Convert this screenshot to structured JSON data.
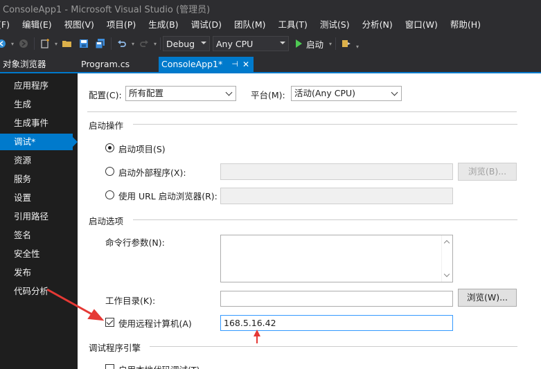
{
  "window": {
    "title": "ConsoleApp1 - Microsoft Visual Studio (管理员)"
  },
  "menu": [
    {
      "label": "(F)",
      "name": "menu-file"
    },
    {
      "label": "编辑(E)",
      "name": "menu-edit"
    },
    {
      "label": "视图(V)",
      "name": "menu-view"
    },
    {
      "label": "项目(P)",
      "name": "menu-project"
    },
    {
      "label": "生成(B)",
      "name": "menu-build"
    },
    {
      "label": "调试(D)",
      "name": "menu-debug"
    },
    {
      "label": "团队(M)",
      "name": "menu-team"
    },
    {
      "label": "工具(T)",
      "name": "menu-tools"
    },
    {
      "label": "测试(S)",
      "name": "menu-test"
    },
    {
      "label": "分析(N)",
      "name": "menu-analyze"
    },
    {
      "label": "窗口(W)",
      "name": "menu-window"
    },
    {
      "label": "帮助(H)",
      "name": "menu-help"
    }
  ],
  "toolbar": {
    "config": "Debug",
    "platform": "Any CPU",
    "start_label": "启动"
  },
  "tabs": {
    "object_browser": "对象浏览器",
    "program_cs": "Program.cs",
    "active": "ConsoleApp1*",
    "pin_glyph": "⊣",
    "close_glyph": "✕"
  },
  "nav": [
    {
      "label": "应用程序",
      "active": false
    },
    {
      "label": "生成",
      "active": false
    },
    {
      "label": "生成事件",
      "active": false
    },
    {
      "label": "调试*",
      "active": true
    },
    {
      "label": "资源",
      "active": false
    },
    {
      "label": "服务",
      "active": false
    },
    {
      "label": "设置",
      "active": false
    },
    {
      "label": "引用路径",
      "active": false
    },
    {
      "label": "签名",
      "active": false
    },
    {
      "label": "安全性",
      "active": false
    },
    {
      "label": "发布",
      "active": false
    },
    {
      "label": "代码分析",
      "active": false
    }
  ],
  "config_row": {
    "config_label": "配置(C):",
    "config_value": "所有配置",
    "platform_label": "平台(M):",
    "platform_value": "活动(Any CPU)"
  },
  "start_action": {
    "section": "启动操作",
    "start_project": "启动项目(S)",
    "start_external": "启动外部程序(X):",
    "start_url": "使用 URL 启动浏览器(R):",
    "browse_label": "浏览(B)...",
    "selected": "start_project"
  },
  "start_options": {
    "section": "启动选项",
    "cmd_args_label": "命令行参数(N):",
    "workdir_label": "工作目录(K):",
    "browse_label": "浏览(W)...",
    "remote_label": "使用远程计算机(A)",
    "remote_checked": true,
    "remote_value": "168.5.16.42"
  },
  "debugger_engines": {
    "section": "调试程序引擎",
    "native_label": "启用本地代码调试(T)"
  },
  "colors": {
    "accent": "#007acc",
    "annotation": "#e53935"
  }
}
